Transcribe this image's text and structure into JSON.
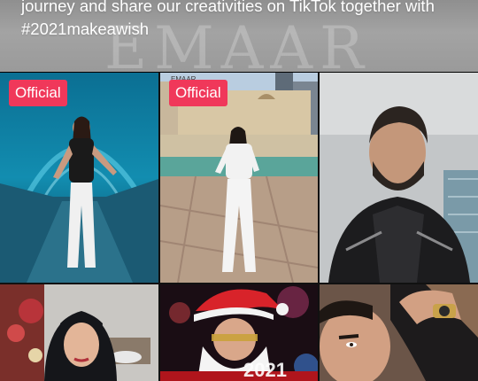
{
  "header": {
    "line1": "journey and share our creativities on TikTok together with",
    "line2": "#2021makeawish",
    "watermark": "EMAAR"
  },
  "videos": [
    {
      "badge": "Official",
      "scene": "aquarium tunnel dancer"
    },
    {
      "badge": "Official",
      "scene": "city plaza dancer",
      "sign": "EMAAR"
    },
    {
      "scene": "bearded man portrait"
    },
    {
      "scene": "woman in hijab with christmas decor"
    },
    {
      "scene": "man in santa costume",
      "overlay": "2021"
    },
    {
      "scene": "man close-up with watch"
    }
  ],
  "colors": {
    "badge": "#f0385a",
    "text": "#ffffff"
  }
}
